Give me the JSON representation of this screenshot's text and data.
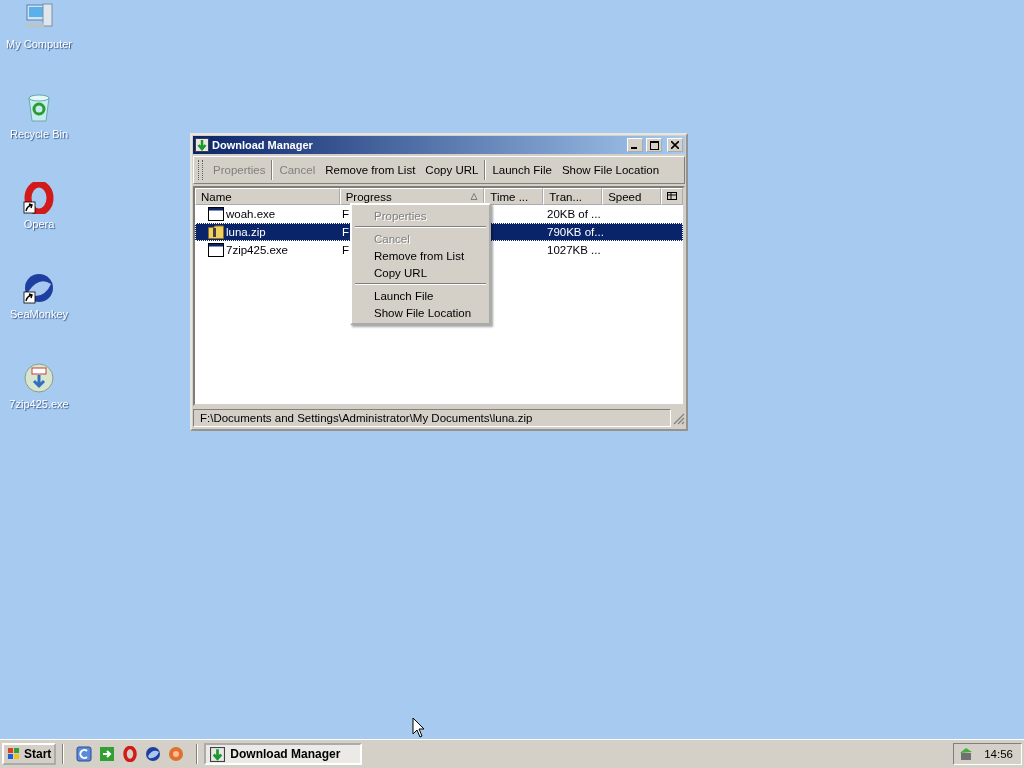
{
  "desktop_icons": [
    {
      "label": "My Computer",
      "kind": "computer",
      "shortcut": false
    },
    {
      "label": "Recycle Bin",
      "kind": "recycle",
      "shortcut": false
    },
    {
      "label": "Opera",
      "kind": "opera",
      "shortcut": true
    },
    {
      "label": "SeaMonkey",
      "kind": "seamonkey",
      "shortcut": true
    },
    {
      "label": "7zip425.exe",
      "kind": "installer",
      "shortcut": false
    }
  ],
  "window": {
    "title": "Download Manager",
    "toolbar": [
      [
        {
          "label": "Properties",
          "disabled": true
        }
      ],
      [
        {
          "label": "Cancel",
          "disabled": true
        },
        {
          "label": "Remove from List",
          "disabled": false
        },
        {
          "label": "Copy URL",
          "disabled": false
        }
      ],
      [
        {
          "label": "Launch File",
          "disabled": false
        },
        {
          "label": "Show File Location",
          "disabled": false
        }
      ]
    ],
    "columns": [
      {
        "label": "Name",
        "sorted": false
      },
      {
        "label": "Progress",
        "sorted": true
      },
      {
        "label": "Time ...",
        "sorted": false
      },
      {
        "label": "Tran...",
        "sorted": false
      },
      {
        "label": "Speed",
        "sorted": false
      }
    ],
    "rows": [
      {
        "kind": "exe",
        "name": "woah.exe",
        "progress": "F",
        "transferred": "20KB of ...",
        "selected": false
      },
      {
        "kind": "zip",
        "name": "luna.zip",
        "progress": "F",
        "transferred": "790KB of...",
        "selected": true
      },
      {
        "kind": "exe",
        "name": "7zip425.exe",
        "progress": "F",
        "transferred": "1027KB ...",
        "selected": false
      }
    ],
    "status_bar": "F:\\Documents and Settings\\Administrator\\My Documents\\luna.zip"
  },
  "context_menu": [
    [
      {
        "label": "Properties",
        "disabled": true
      }
    ],
    [
      {
        "label": "Cancel",
        "disabled": true
      },
      {
        "label": "Remove from List",
        "disabled": false
      },
      {
        "label": "Copy URL",
        "disabled": false
      }
    ],
    [
      {
        "label": "Launch File",
        "disabled": false
      },
      {
        "label": "Show File Location",
        "disabled": false
      }
    ]
  ],
  "taskbar": {
    "start": "Start",
    "tasks": [
      {
        "label": "Download Manager",
        "selected": true
      }
    ],
    "clock": "14:56"
  }
}
